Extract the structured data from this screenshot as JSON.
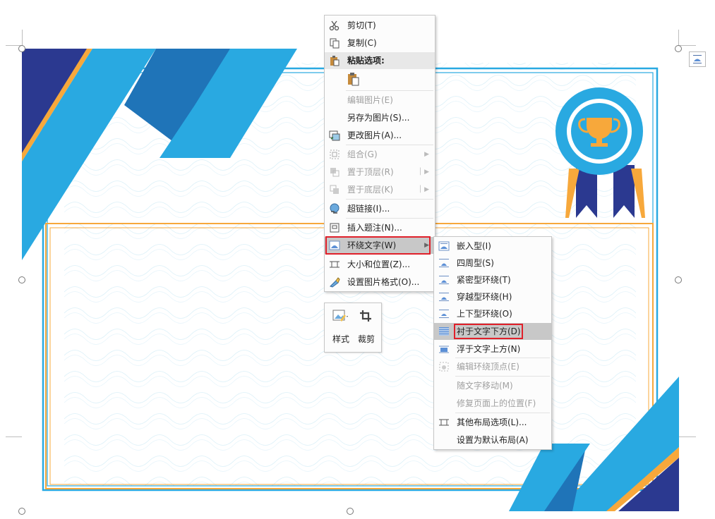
{
  "context_menu": {
    "items": [
      {
        "label": "剪切(T)",
        "icon": "scissors-icon",
        "enabled": true
      },
      {
        "label": "复制(C)",
        "icon": "copy-icon",
        "enabled": true
      },
      {
        "label": "粘贴选项:",
        "icon": "paste-icon",
        "enabled": true
      },
      {
        "label": "编辑图片(E)",
        "enabled": false
      },
      {
        "label": "另存为图片(S)...",
        "enabled": true
      },
      {
        "label": "更改图片(A)...",
        "icon": "change-picture-icon",
        "enabled": true
      },
      {
        "label": "组合(G)",
        "icon": "group-icon",
        "enabled": false
      },
      {
        "label": "置于顶层(R)",
        "icon": "bring-to-front-icon",
        "enabled": false
      },
      {
        "label": "置于底层(K)",
        "icon": "send-to-back-icon",
        "enabled": false
      },
      {
        "label": "超链接(I)...",
        "icon": "hyperlink-icon",
        "enabled": true
      },
      {
        "label": "插入题注(N)...",
        "icon": "caption-icon",
        "enabled": true
      },
      {
        "label": "环绕文字(W)",
        "icon": "wrap-text-icon",
        "enabled": true
      },
      {
        "label": "大小和位置(Z)...",
        "icon": "size-position-icon",
        "enabled": true
      },
      {
        "label": "设置图片格式(O)...",
        "icon": "format-picture-icon",
        "enabled": true
      }
    ]
  },
  "mini_toolbar": {
    "style_label": "样式",
    "crop_label": "裁剪"
  },
  "wrap_submenu": {
    "items": [
      {
        "label": "嵌入型(I)",
        "enabled": true
      },
      {
        "label": "四周型(S)",
        "enabled": true
      },
      {
        "label": "紧密型环绕(T)",
        "enabled": true
      },
      {
        "label": "穿越型环绕(H)",
        "enabled": true
      },
      {
        "label": "上下型环绕(O)",
        "enabled": true
      },
      {
        "label": "衬于文字下方(D)",
        "enabled": true
      },
      {
        "label": "浮于文字上方(N)",
        "enabled": true
      },
      {
        "label": "编辑环绕顶点(E)",
        "enabled": false
      },
      {
        "label": "随文字移动(M)",
        "enabled": false
      },
      {
        "label": "修复页面上的位置(F)",
        "enabled": false
      },
      {
        "label": "其他布局选项(L)...",
        "enabled": true
      },
      {
        "label": "设置为默认布局(A)",
        "enabled": true
      }
    ]
  },
  "colors": {
    "navy": "#2b3990",
    "blue": "#29a9e1",
    "mid_blue": "#1f74b8",
    "orange": "#f7a83b",
    "highlight_red": "#e0202a"
  }
}
